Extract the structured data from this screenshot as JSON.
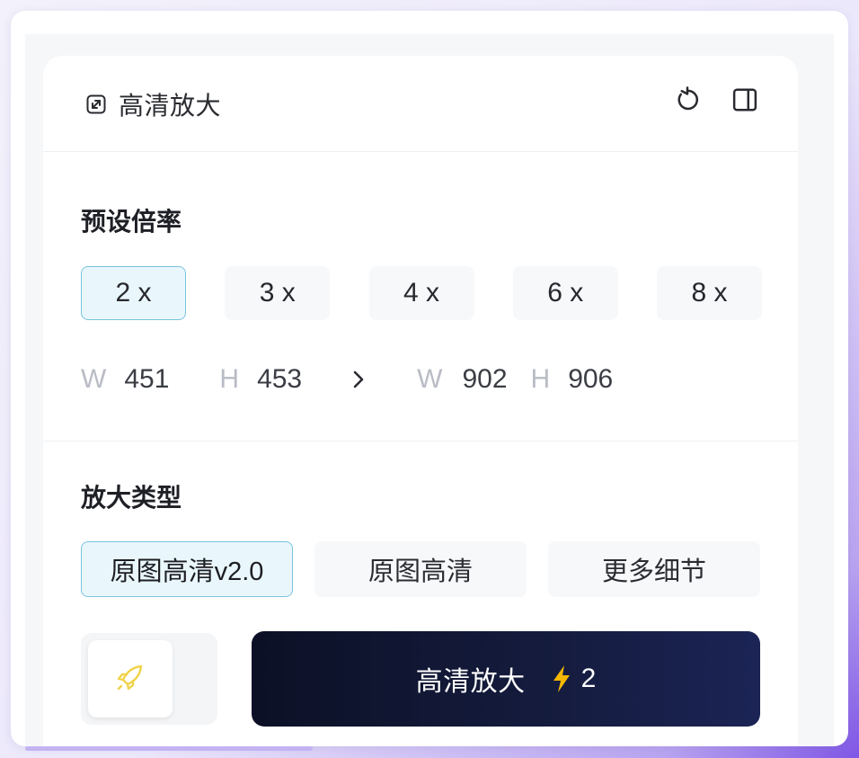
{
  "header": {
    "title": "高清放大",
    "title_icon": "expand-icon",
    "reset_icon": "reset-icon",
    "panel_icon": "side-panel-icon"
  },
  "preset_scale": {
    "section_title": "预设倍率",
    "options": [
      "2 x",
      "3 x",
      "4 x",
      "6 x",
      "8 x"
    ],
    "selected": "2 x"
  },
  "dimensions": {
    "source": {
      "w_label": "W",
      "w_value": "451",
      "h_label": "H",
      "h_value": "453"
    },
    "target": {
      "w_label": "W",
      "w_value": "902",
      "h_label": "H",
      "h_value": "906"
    },
    "arrow_icon": "chevron-right-icon"
  },
  "upscale_type": {
    "section_title": "放大类型",
    "options": [
      "原图高清v2.0",
      "原图高清",
      "更多细节"
    ],
    "selected": "原图高清v2.0"
  },
  "actions": {
    "rocket_icon": "rocket-icon",
    "main_label": "高清放大",
    "bolt_icon": "lightning-icon",
    "credit_cost": "2"
  },
  "colors": {
    "accent_border": "#79c4dc",
    "accent_bg": "#e9f7fd",
    "main_button": "#141b3c",
    "bolt": "#f5b800"
  }
}
